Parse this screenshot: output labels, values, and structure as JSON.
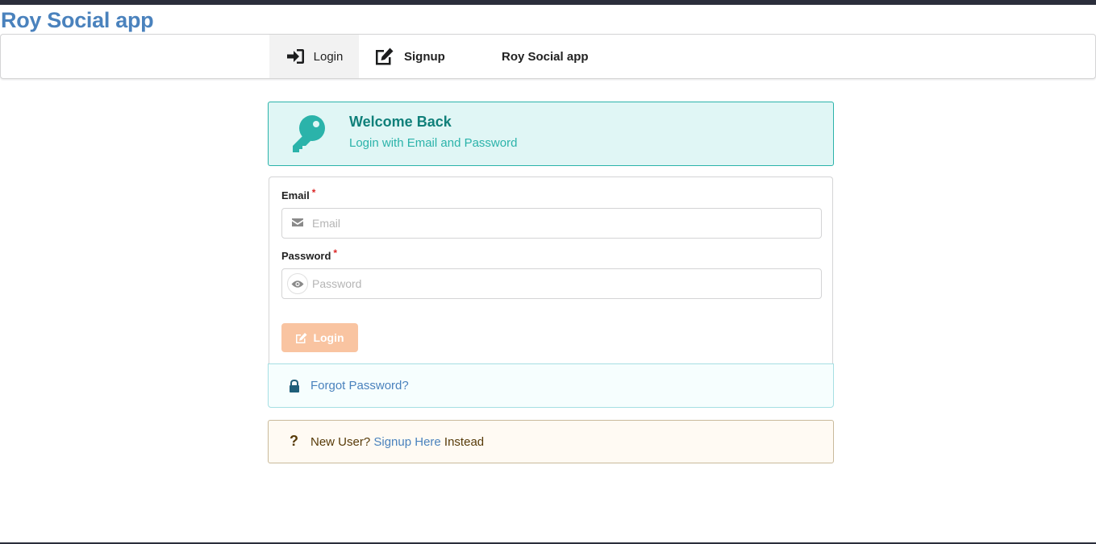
{
  "app": {
    "title": "Roy Social app"
  },
  "navbar": {
    "items": [
      {
        "label": "Login",
        "icon": "sign-in-icon",
        "active": true
      },
      {
        "label": "Signup",
        "icon": "edit-icon",
        "active": false
      },
      {
        "label": "Roy Social app",
        "icon": "",
        "active": false
      }
    ]
  },
  "welcome": {
    "icon": "key-icon",
    "title": "Welcome Back",
    "subtitle": "Login with Email and Password"
  },
  "form": {
    "email": {
      "label": "Email",
      "required_mark": "*",
      "placeholder": "Email",
      "value": "",
      "icon": "envelope-icon"
    },
    "password": {
      "label": "Password",
      "required_mark": "*",
      "placeholder": "Password",
      "value": "",
      "icon": "eye-icon"
    },
    "submit_label": "Login",
    "submit_icon": "edit-icon"
  },
  "forgot": {
    "icon": "lock-icon",
    "link": "Forgot Password?"
  },
  "new_user": {
    "icon": "question-icon",
    "icon_glyph": "?",
    "prefix": "New User?",
    "link": "Signup Here",
    "suffix": "Instead"
  },
  "colors": {
    "brand": "#4a82bd",
    "teal": "#2bb3aa",
    "teal_dark": "#10807a",
    "teal_bg": "#e0f6f5",
    "login_button": "#f9c4a1",
    "warning_text": "#573a08",
    "warning_bg": "#fffaf3",
    "top_bar": "#2b2e3b"
  }
}
